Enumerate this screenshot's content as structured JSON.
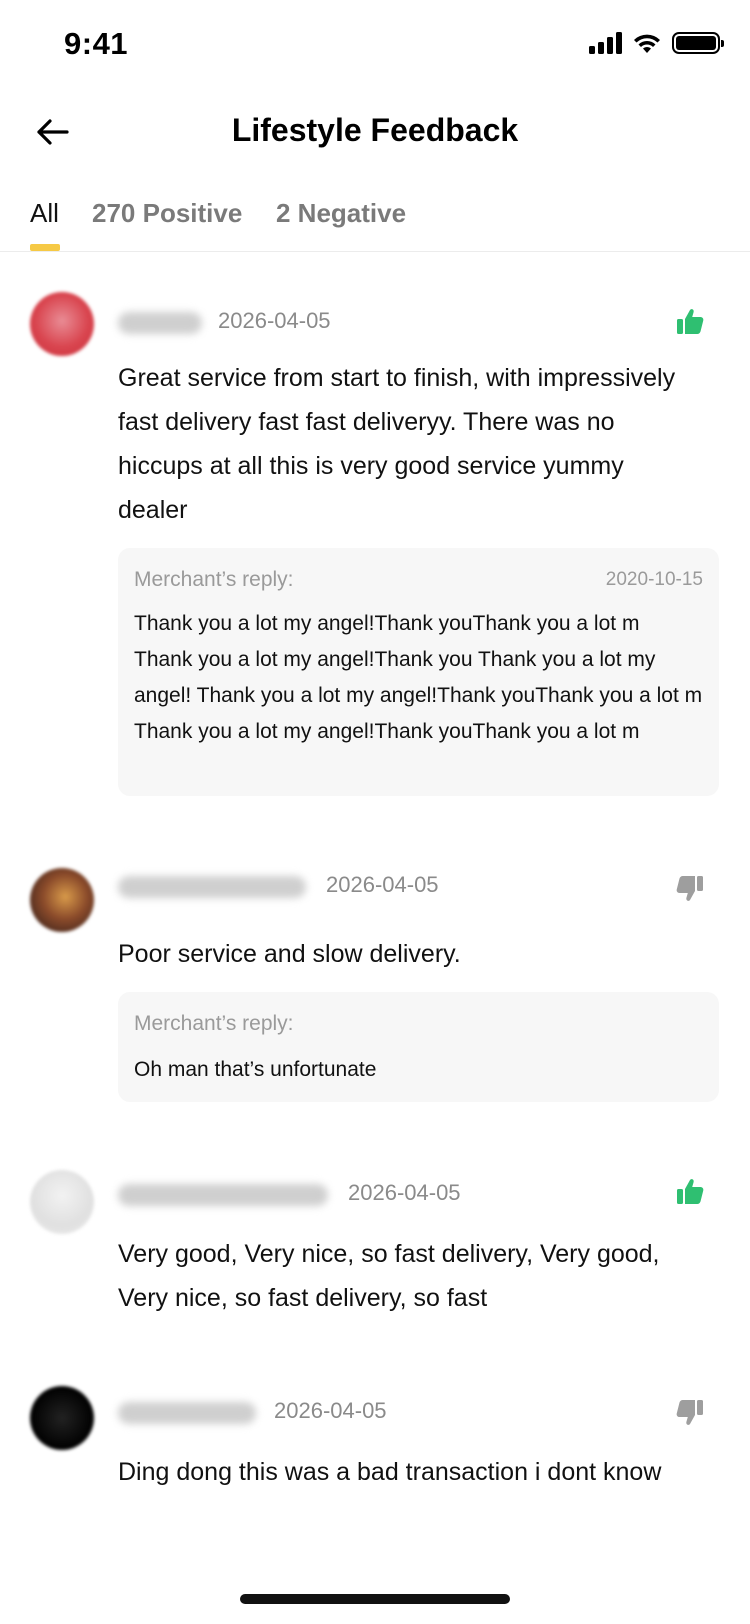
{
  "status_bar": {
    "time": "9:41"
  },
  "header": {
    "title": "Lifestyle Feedback"
  },
  "tabs": [
    {
      "label": "All"
    },
    {
      "label": "270 Positive"
    },
    {
      "label": "2 Negative"
    }
  ],
  "reviews": [
    {
      "date": "2026-04-05",
      "rating": "positive",
      "text": "Great service from start to finish, with impressively fast delivery fast fast deliveryy. There was no hiccups at all this is very good service yummy dealer",
      "reply": {
        "label": "Merchant’s reply:",
        "date": "2020-10-15",
        "text": "Thank you a lot my angel!Thank youThank you a lot m Thank you a lot my angel!Thank you Thank you a lot my angel! Thank you a lot my angel!Thank youThank you a lot m Thank you a lot my angel!Thank youThank you a lot m"
      }
    },
    {
      "date": "2026-04-05",
      "rating": "negative",
      "text": "Poor service and slow delivery.",
      "reply": {
        "label": "Merchant’s reply:",
        "text": "Oh man that’s unfortunate"
      }
    },
    {
      "date": "2026-04-05",
      "rating": "positive",
      "text": "Very good, Very nice, so fast delivery, Very good, Very nice, so fast delivery, so fast"
    },
    {
      "date": "2026-04-05",
      "rating": "negative",
      "text": "Ding dong this was a bad transaction i dont know why the seller was forcing me to type in a certain way"
    }
  ],
  "colors": {
    "accent": "#f6c945",
    "positive": "#2fbf71",
    "negative": "#9e9e9e"
  }
}
